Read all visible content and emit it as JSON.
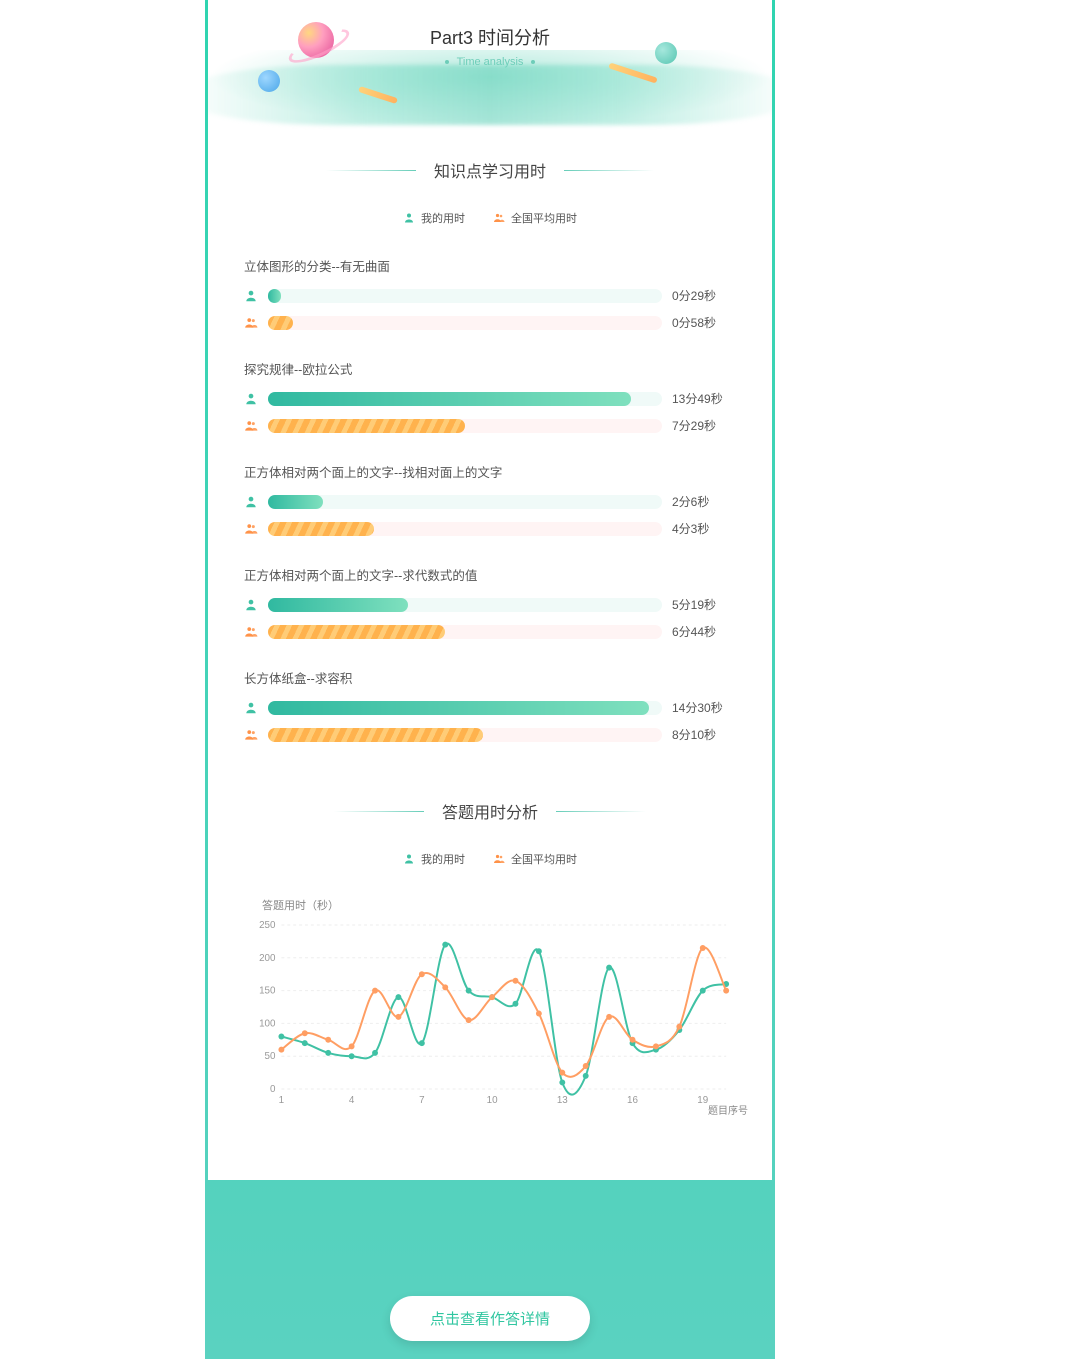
{
  "header": {
    "title": "Part3 时间分析",
    "subtitle": "Time analysis"
  },
  "sections": {
    "knowledge": {
      "title": "知识点学习用时",
      "legend": {
        "my": "我的用时",
        "avg": "全国平均用时"
      }
    },
    "answer": {
      "title": "答题用时分析",
      "legend": {
        "my": "我的用时",
        "avg": "全国平均用时"
      },
      "yaxis_title": "答题用时（秒）",
      "xaxis_title": "题目序号"
    }
  },
  "topics": [
    {
      "title": "立体图形的分类--有无曲面",
      "my_label": "0分29秒",
      "avg_label": "0分58秒",
      "my_seconds": 29,
      "avg_seconds": 58,
      "max_seconds": 900
    },
    {
      "title": "探究规律--欧拉公式",
      "my_label": "13分49秒",
      "avg_label": "7分29秒",
      "my_seconds": 829,
      "avg_seconds": 449,
      "max_seconds": 900
    },
    {
      "title": "正方体相对两个面上的文字--找相对面上的文字",
      "my_label": "2分6秒",
      "avg_label": "4分3秒",
      "my_seconds": 126,
      "avg_seconds": 243,
      "max_seconds": 900
    },
    {
      "title": "正方体相对两个面上的文字--求代数式的值",
      "my_label": "5分19秒",
      "avg_label": "6分44秒",
      "my_seconds": 319,
      "avg_seconds": 404,
      "max_seconds": 900
    },
    {
      "title": "长方体纸盒--求容积",
      "my_label": "14分30秒",
      "avg_label": "8分10秒",
      "my_seconds": 870,
      "avg_seconds": 490,
      "max_seconds": 900
    }
  ],
  "chart_data": {
    "type": "line",
    "title": "答题用时分析",
    "xlabel": "题目序号",
    "ylabel": "答题用时（秒）",
    "ylim": [
      0,
      250
    ],
    "yticks": [
      0,
      50,
      100,
      150,
      200,
      250
    ],
    "xticks": [
      1,
      4,
      7,
      10,
      13,
      16,
      19
    ],
    "x": [
      1,
      2,
      3,
      4,
      5,
      6,
      7,
      8,
      9,
      10,
      11,
      12,
      13,
      14,
      15,
      16,
      17,
      18,
      19,
      20
    ],
    "series": [
      {
        "name": "我的用时",
        "color": "#3fc1a4",
        "values": [
          80,
          70,
          55,
          50,
          55,
          140,
          70,
          220,
          150,
          140,
          130,
          210,
          10,
          20,
          185,
          70,
          60,
          90,
          150,
          160
        ]
      },
      {
        "name": "全国平均用时",
        "color": "#ff9e63",
        "values": [
          60,
          85,
          75,
          65,
          150,
          110,
          175,
          155,
          105,
          140,
          165,
          115,
          25,
          35,
          110,
          75,
          65,
          95,
          215,
          150
        ]
      }
    ]
  },
  "cta": {
    "label": "点击查看作答详情"
  }
}
